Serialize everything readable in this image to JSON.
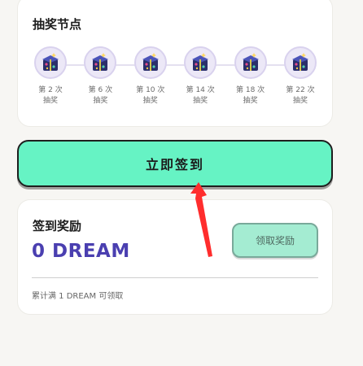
{
  "lottery": {
    "title": "抽奖节点",
    "nodes": [
      {
        "line1": "第 2 次",
        "line2": "抽奖",
        "icon": "mystery-box-icon"
      },
      {
        "line1": "第 6 次",
        "line2": "抽奖",
        "icon": "mystery-box-icon"
      },
      {
        "line1": "第 10 次",
        "line2": "抽奖",
        "icon": "mystery-box-icon"
      },
      {
        "line1": "第 14 次",
        "line2": "抽奖",
        "icon": "mystery-box-icon"
      },
      {
        "line1": "第 18 次",
        "line2": "抽奖",
        "icon": "mystery-box-icon"
      },
      {
        "line1": "第 22 次",
        "line2": "抽奖",
        "icon": "mystery-box-icon"
      }
    ]
  },
  "signin": {
    "button_label": "立即签到"
  },
  "reward": {
    "title": "签到奖励",
    "amount": "0 DREAM",
    "claim_label": "领取奖励",
    "note": "累计满 1 DREAM 可领取"
  },
  "colors": {
    "accent_green": "#66f3c4",
    "amount_purple": "#4a3fb0",
    "arrow_red": "#ff2d2d"
  }
}
